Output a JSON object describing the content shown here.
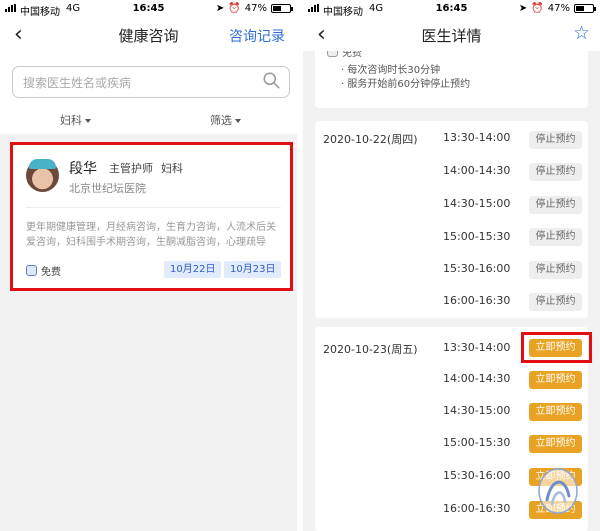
{
  "status_bar": {
    "carrier": "中国移动",
    "network": "4G",
    "time": "16:45",
    "battery": "47%",
    "battery_level": 0.47
  },
  "left": {
    "nav": {
      "title": "健康咨询",
      "right_link": "咨询记录"
    },
    "search": {
      "placeholder": "搜索医生姓名或疾病"
    },
    "filters": {
      "department": "妇科",
      "screen": "筛选"
    },
    "doctor": {
      "name": "段华",
      "title": "主管护师",
      "department": "妇科",
      "hospital": "北京世纪坛医院",
      "specialty": "更年期健康管理，月经病咨询，生育力咨询，人流术后关爱咨询，妇科围手术期咨询，生酮减脂咨询，心理疏导",
      "fee": "免费",
      "dates": [
        "10月22日",
        "10月23日"
      ]
    }
  },
  "right": {
    "nav": {
      "title": "医生详情"
    },
    "info": {
      "fee": "免费",
      "notes": [
        "· 每次咨询时长30分钟",
        "· 服务开始前60分钟停止预约"
      ]
    },
    "days": [
      {
        "date": "2020-10-22(周四)",
        "slots": [
          {
            "time": "13:30-14:00",
            "action": "停止预约"
          },
          {
            "time": "14:00-14:30",
            "action": "停止预约"
          },
          {
            "time": "14:30-15:00",
            "action": "停止预约"
          },
          {
            "time": "15:00-15:30",
            "action": "停止预约"
          },
          {
            "time": "15:30-16:00",
            "action": "停止预约"
          },
          {
            "time": "16:00-16:30",
            "action": "停止预约"
          }
        ]
      },
      {
        "date": "2020-10-23(周五)",
        "slots": [
          {
            "time": "13:30-14:00",
            "action": "立即预约"
          },
          {
            "time": "14:00-14:30",
            "action": "立即预约"
          },
          {
            "time": "14:30-15:00",
            "action": "立即预约"
          },
          {
            "time": "15:00-15:30",
            "action": "立即预约"
          },
          {
            "time": "15:30-16:00",
            "action": "立即预约"
          },
          {
            "time": "16:00-16:30",
            "action": "立即预约"
          }
        ]
      }
    ]
  },
  "colors": {
    "accent_blue": "#2f6fd9",
    "book_orange": "#e8a324",
    "highlight_red": "#e20f12"
  }
}
